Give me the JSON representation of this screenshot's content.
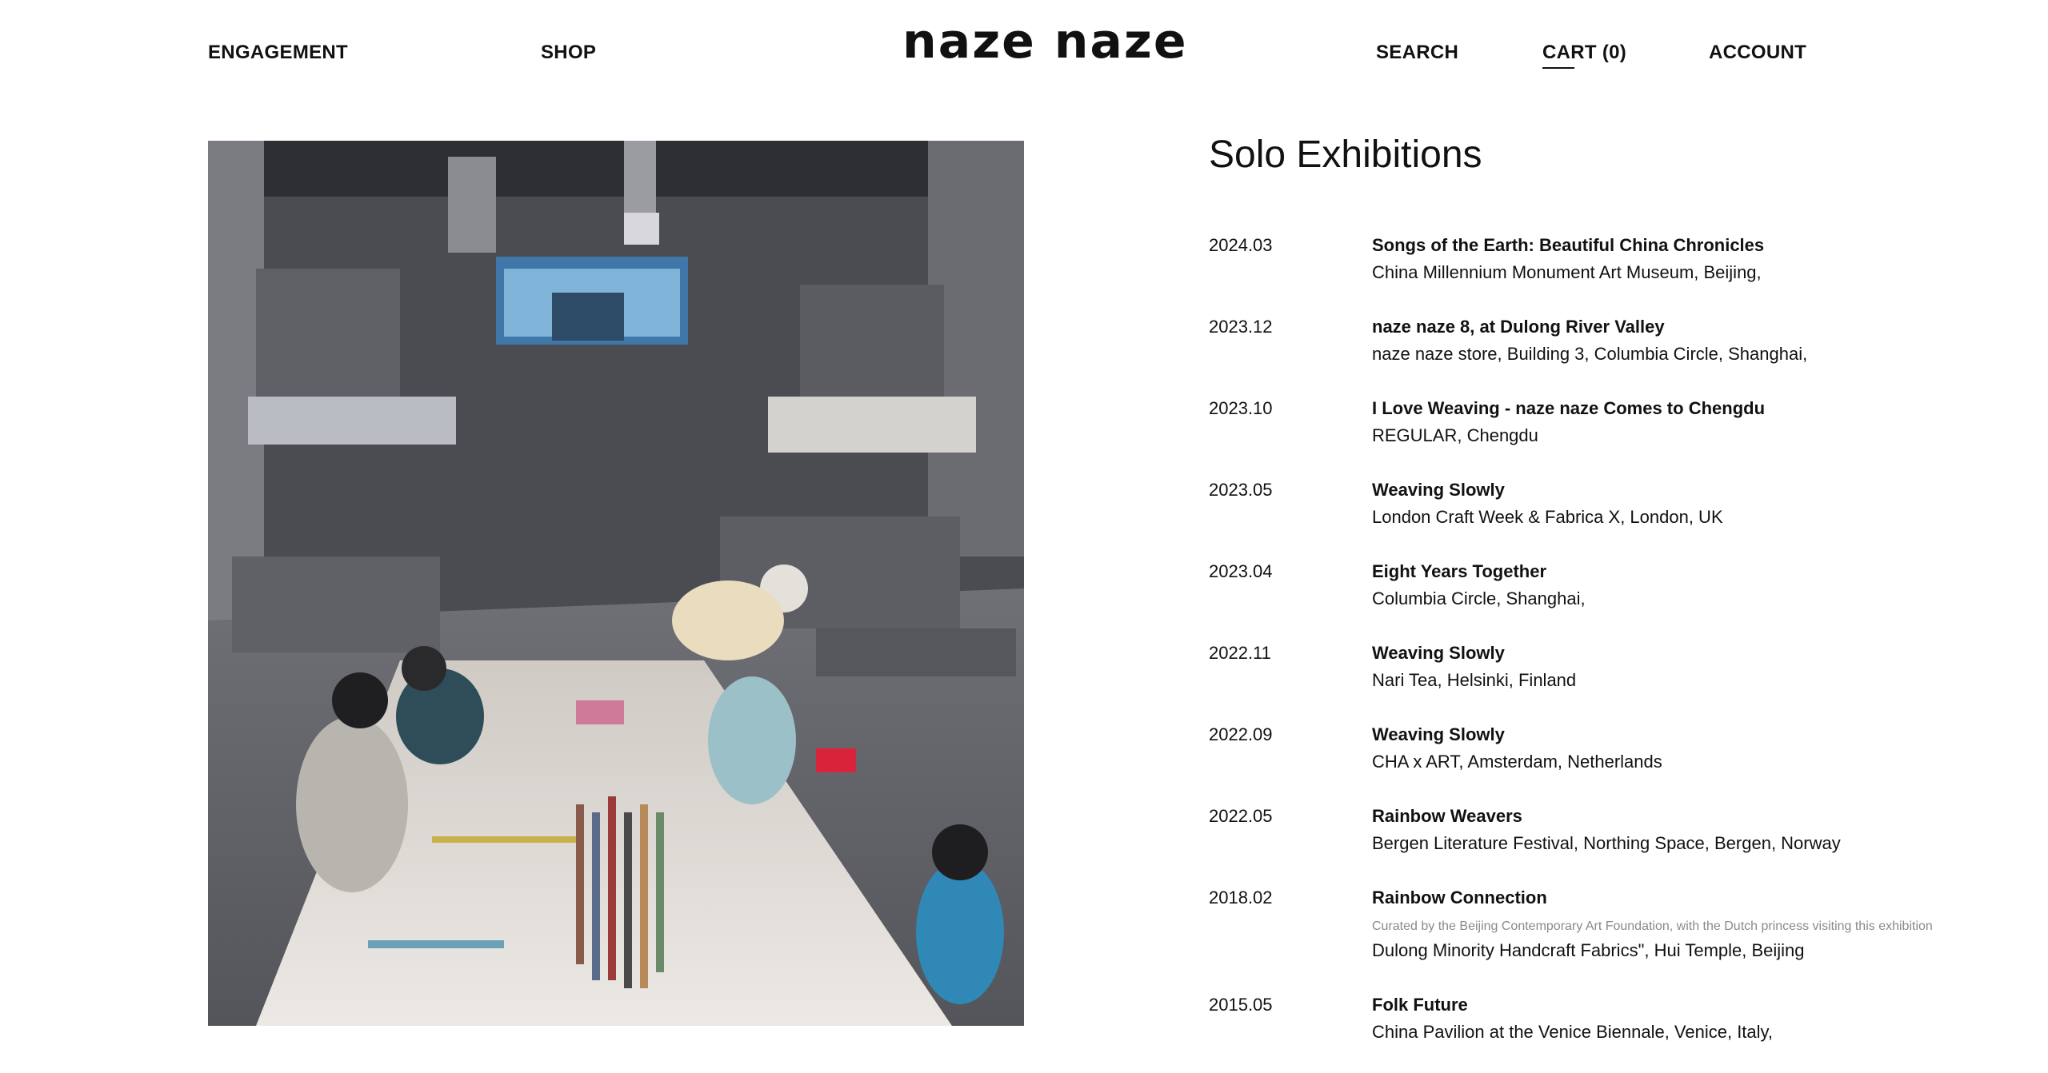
{
  "header": {
    "nav_left": [
      "ENGAGEMENT",
      "SHOP"
    ],
    "logo": "naze naze",
    "search_label": "SEARCH",
    "cart_label": "CART (0)",
    "account_label": "ACCOUNT"
  },
  "main": {
    "photo_icon": "exhibition-photo",
    "section_title": "Solo Exhibitions",
    "exhibitions": [
      {
        "date": "2024.03",
        "title": "Songs of the Earth: Beautiful China Chronicles",
        "note": "",
        "venue": "China Millennium Monument Art Museum, Beijing,"
      },
      {
        "date": "2023.12",
        "title": "naze naze 8, at Dulong River Valley",
        "note": "",
        "venue": "naze naze store, Building 3, Columbia Circle, Shanghai,"
      },
      {
        "date": "2023.10",
        "title": "I Love Weaving - naze naze Comes to Chengdu",
        "note": "",
        "venue": "REGULAR, Chengdu"
      },
      {
        "date": "2023.05",
        "title": "Weaving Slowly",
        "note": "",
        "venue": "London Craft Week & Fabrica X, London, UK"
      },
      {
        "date": "2023.04",
        "title": "Eight Years Together",
        "note": "",
        "venue": "Columbia Circle, Shanghai,"
      },
      {
        "date": "2022.11",
        "title": "Weaving Slowly",
        "note": "",
        "venue": "Nari Tea, Helsinki, Finland"
      },
      {
        "date": "2022.09",
        "title": "Weaving Slowly",
        "note": "",
        "venue": "CHA x ART, Amsterdam, Netherlands"
      },
      {
        "date": "2022.05",
        "title": "Rainbow Weavers",
        "note": "",
        "venue": "Bergen Literature Festival, Northing Space, Bergen, Norway"
      },
      {
        "date": "2018.02",
        "title": "Rainbow Connection",
        "note": "Curated by the Beijing Contemporary Art Foundation, with the Dutch princess visiting this exhibition",
        "venue": "Dulong Minority Handcraft Fabrics\", Hui Temple, Beijing"
      },
      {
        "date": "2015.05",
        "title": "Folk Future",
        "note": "",
        "venue": "China Pavilion at the Venice Biennale, Venice, Italy,"
      }
    ]
  }
}
